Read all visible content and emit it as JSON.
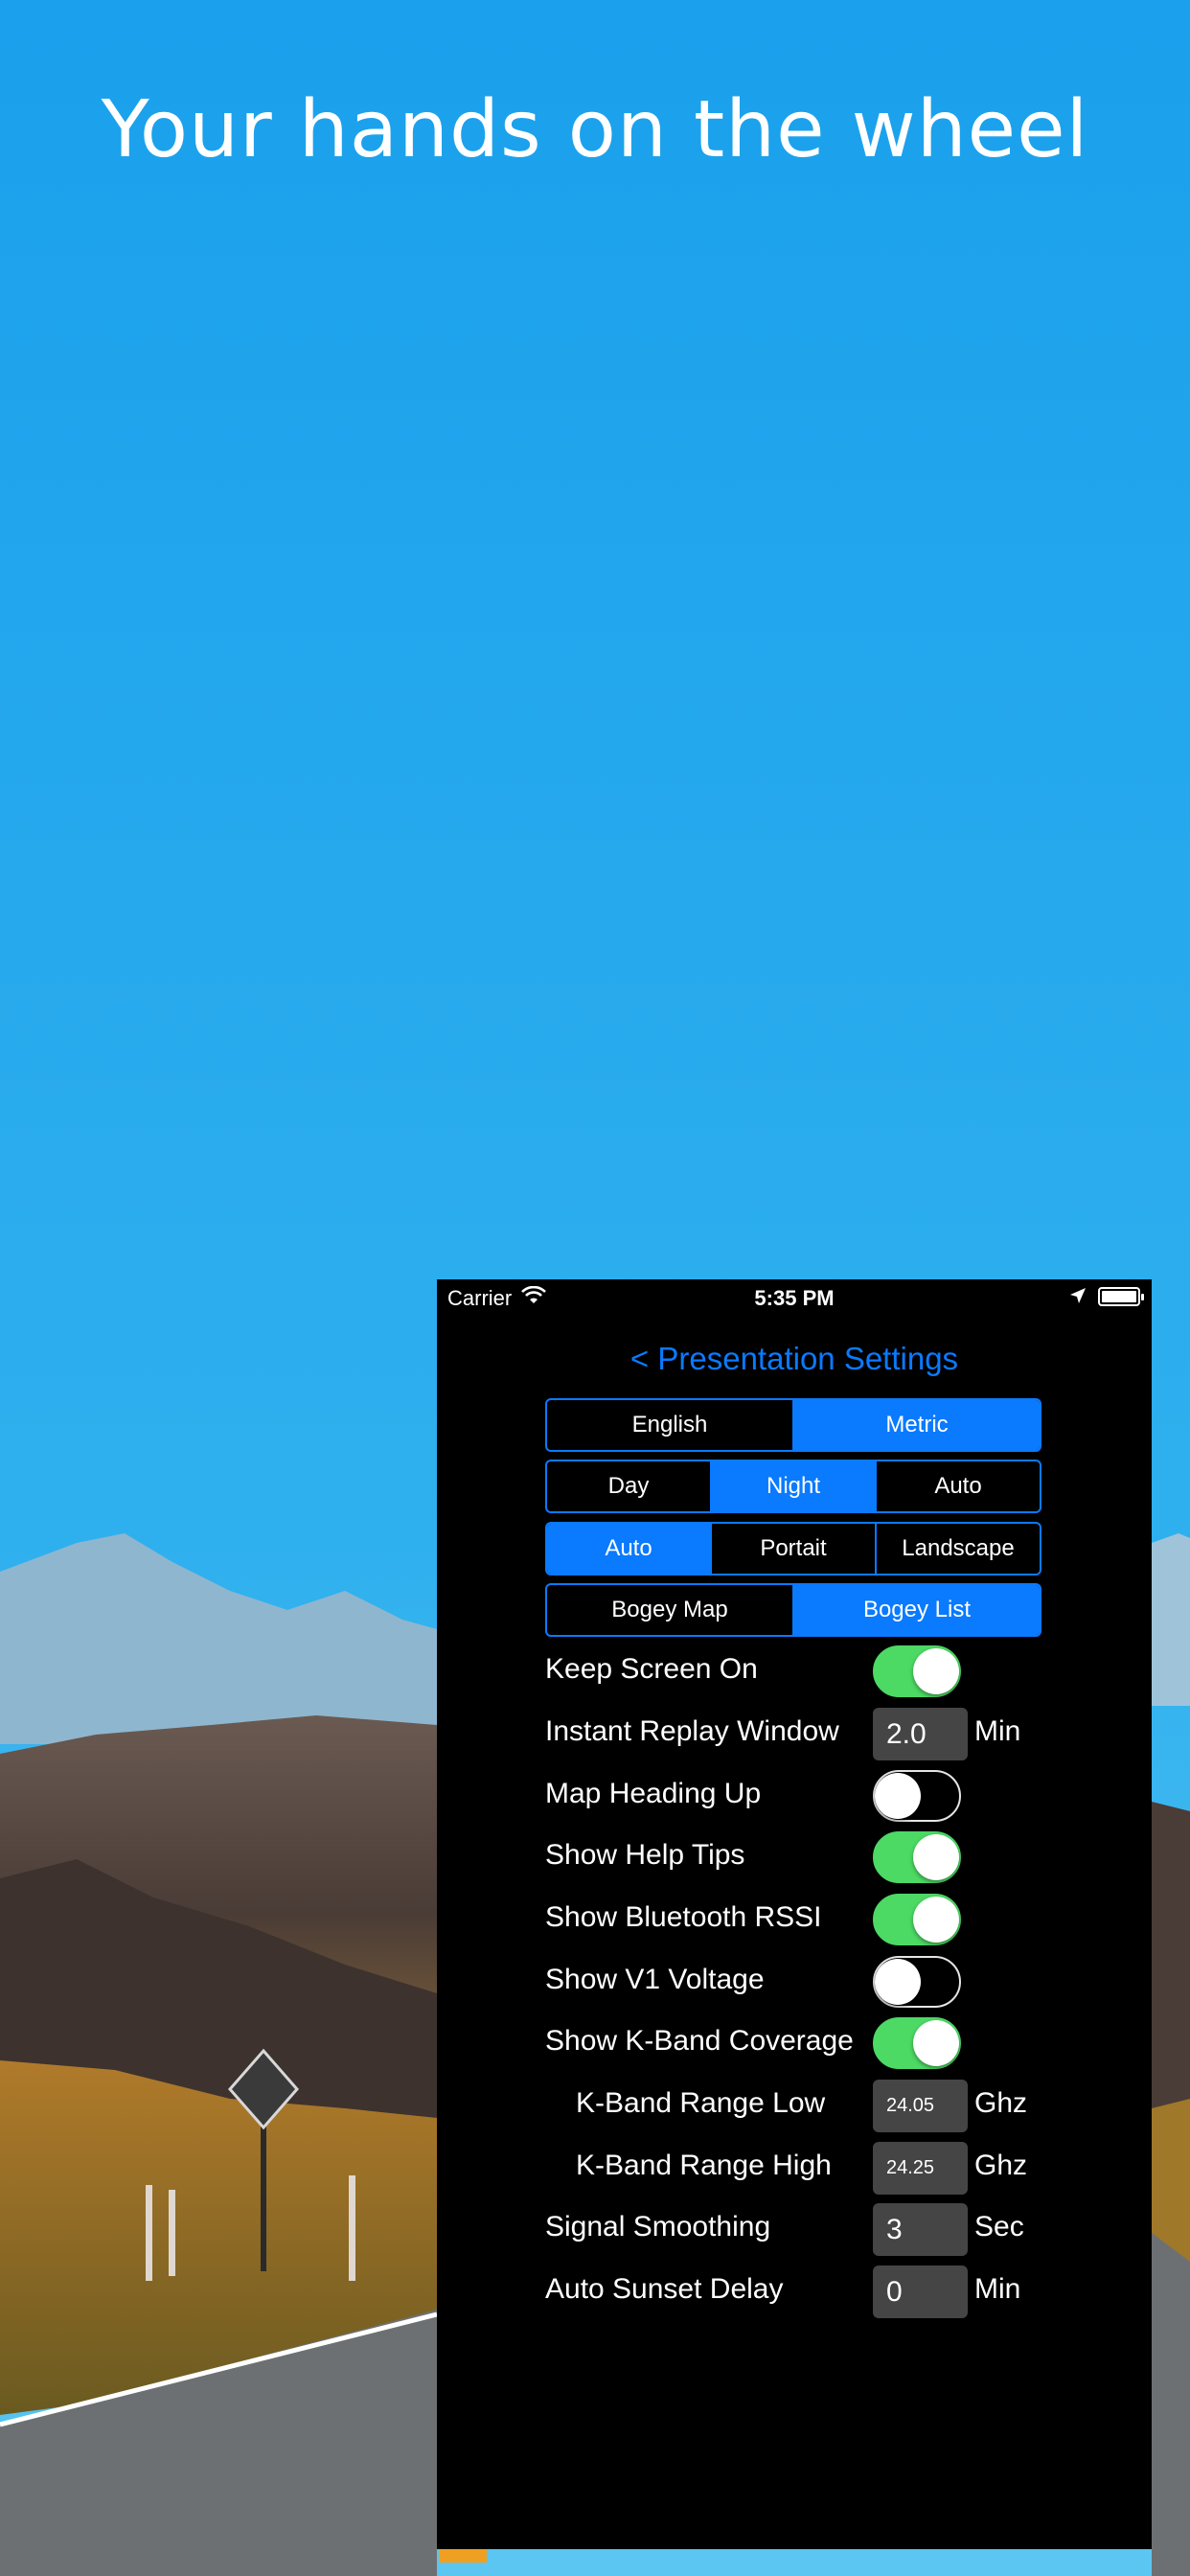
{
  "headline": "Your hands on the wheel",
  "status_bar": {
    "carrier": "Carrier",
    "time": "5:35 PM",
    "icons": [
      "wifi-icon",
      "location-arrow-icon",
      "battery-icon"
    ]
  },
  "nav": {
    "title": "< Presentation Settings"
  },
  "segments": {
    "units": {
      "options": [
        "English",
        "Metric"
      ],
      "selected": "Metric"
    },
    "theme": {
      "options": [
        "Day",
        "Night",
        "Auto"
      ],
      "selected": "Night"
    },
    "orientation": {
      "options": [
        "Auto",
        "Portait",
        "Landscape"
      ],
      "selected": "Auto"
    },
    "view": {
      "options": [
        "Bogey Map",
        "Bogey List"
      ],
      "selected": "Bogey List"
    }
  },
  "settings": [
    {
      "label": "Keep Screen On",
      "type": "toggle",
      "on": true
    },
    {
      "label": "Instant Replay Window",
      "type": "field",
      "value": "2.0",
      "unit": "Min"
    },
    {
      "label": "Map Heading Up",
      "type": "toggle",
      "on": false
    },
    {
      "label": "Show Help Tips",
      "type": "toggle",
      "on": true
    },
    {
      "label": "Show Bluetooth RSSI",
      "type": "toggle",
      "on": true
    },
    {
      "label": "Show V1 Voltage",
      "type": "toggle",
      "on": false
    },
    {
      "label": "Show K-Band Coverage",
      "type": "toggle",
      "on": true
    },
    {
      "label": "K-Band Range Low",
      "type": "field",
      "value": "24.05",
      "unit": "Ghz",
      "indent": true
    },
    {
      "label": "K-Band Range High",
      "type": "field",
      "value": "24.25",
      "unit": "Ghz",
      "indent": true
    },
    {
      "label": "Signal Smoothing",
      "type": "field",
      "value": "3",
      "unit": "Sec"
    },
    {
      "label": "Auto Sunset Delay",
      "type": "field",
      "value": "0",
      "unit": "Min"
    }
  ],
  "colors": {
    "accent": "#0a7aff",
    "toggle_on": "#4cd964",
    "field_bg": "#454545",
    "sky": "#2aa8ea"
  }
}
